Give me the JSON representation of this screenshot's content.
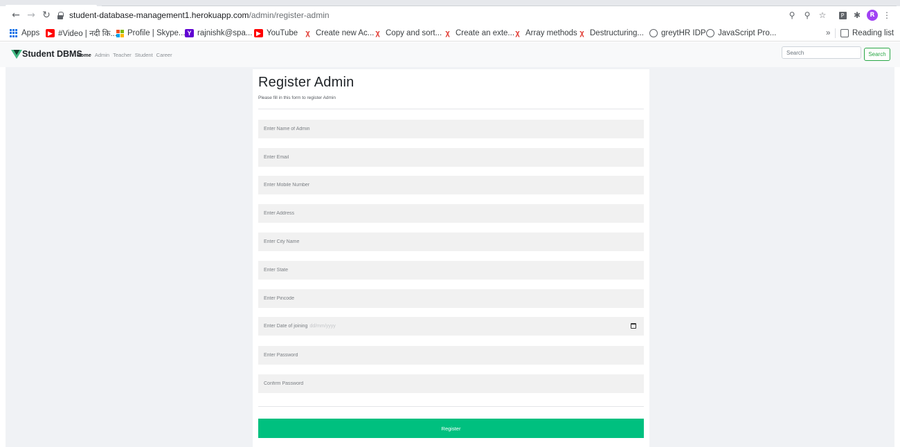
{
  "browser": {
    "url_host": "student-database-management1.herokuapp.com",
    "url_path": "/admin/register-admin",
    "profile_initial": "R",
    "bookmarks": [
      {
        "label": "Apps",
        "icon": "apps-grid-icon"
      },
      {
        "label": "#Video | नदी कि...",
        "icon": "youtube-icon"
      },
      {
        "label": "Profile | Skype...",
        "icon": "microsoft-icon"
      },
      {
        "label": "rajnishk@spa...",
        "icon": "yahoo-icon"
      },
      {
        "label": "YouTube",
        "icon": "youtube-icon"
      },
      {
        "label": "Create new Ac...",
        "icon": "vue-icon"
      },
      {
        "label": "Copy and sort...",
        "icon": "vue-icon"
      },
      {
        "label": "Create an exte...",
        "icon": "vue-icon"
      },
      {
        "label": "Array methods",
        "icon": "vue-icon"
      },
      {
        "label": "Destructuring...",
        "icon": "vue-icon"
      },
      {
        "label": "greytHR IDP",
        "icon": "globe-icon"
      },
      {
        "label": "JavaScript Pro...",
        "icon": "globe-icon"
      }
    ],
    "overflow": "»",
    "reading_list": "Reading list"
  },
  "navbar": {
    "brand": "Student DBMS",
    "brand_color": "#0f5132",
    "links": [
      "Home",
      "Admin",
      "Teacher",
      "Student",
      "Career"
    ],
    "active_link": "Home",
    "search_placeholder": "Search",
    "search_button": "Search"
  },
  "form": {
    "title": "Register Admin",
    "subtitle": "Please fill in this form to register Admin",
    "name_placeholder": "Enter Name of Admin",
    "email_placeholder": "Enter Email",
    "mobile_placeholder": "Enter Mobile Number",
    "address_placeholder": "Enter Address",
    "city_placeholder": "Enter City Name",
    "state_placeholder": "Enter State",
    "pincode_placeholder": "Enter Pincode",
    "date_label": "Enter Date of joining",
    "date_format": "dd/mm/yyyy",
    "password_placeholder": "Enter Password",
    "confirm_placeholder": "Confirm Password",
    "submit": "Register",
    "accent_color": "#00c07f"
  }
}
